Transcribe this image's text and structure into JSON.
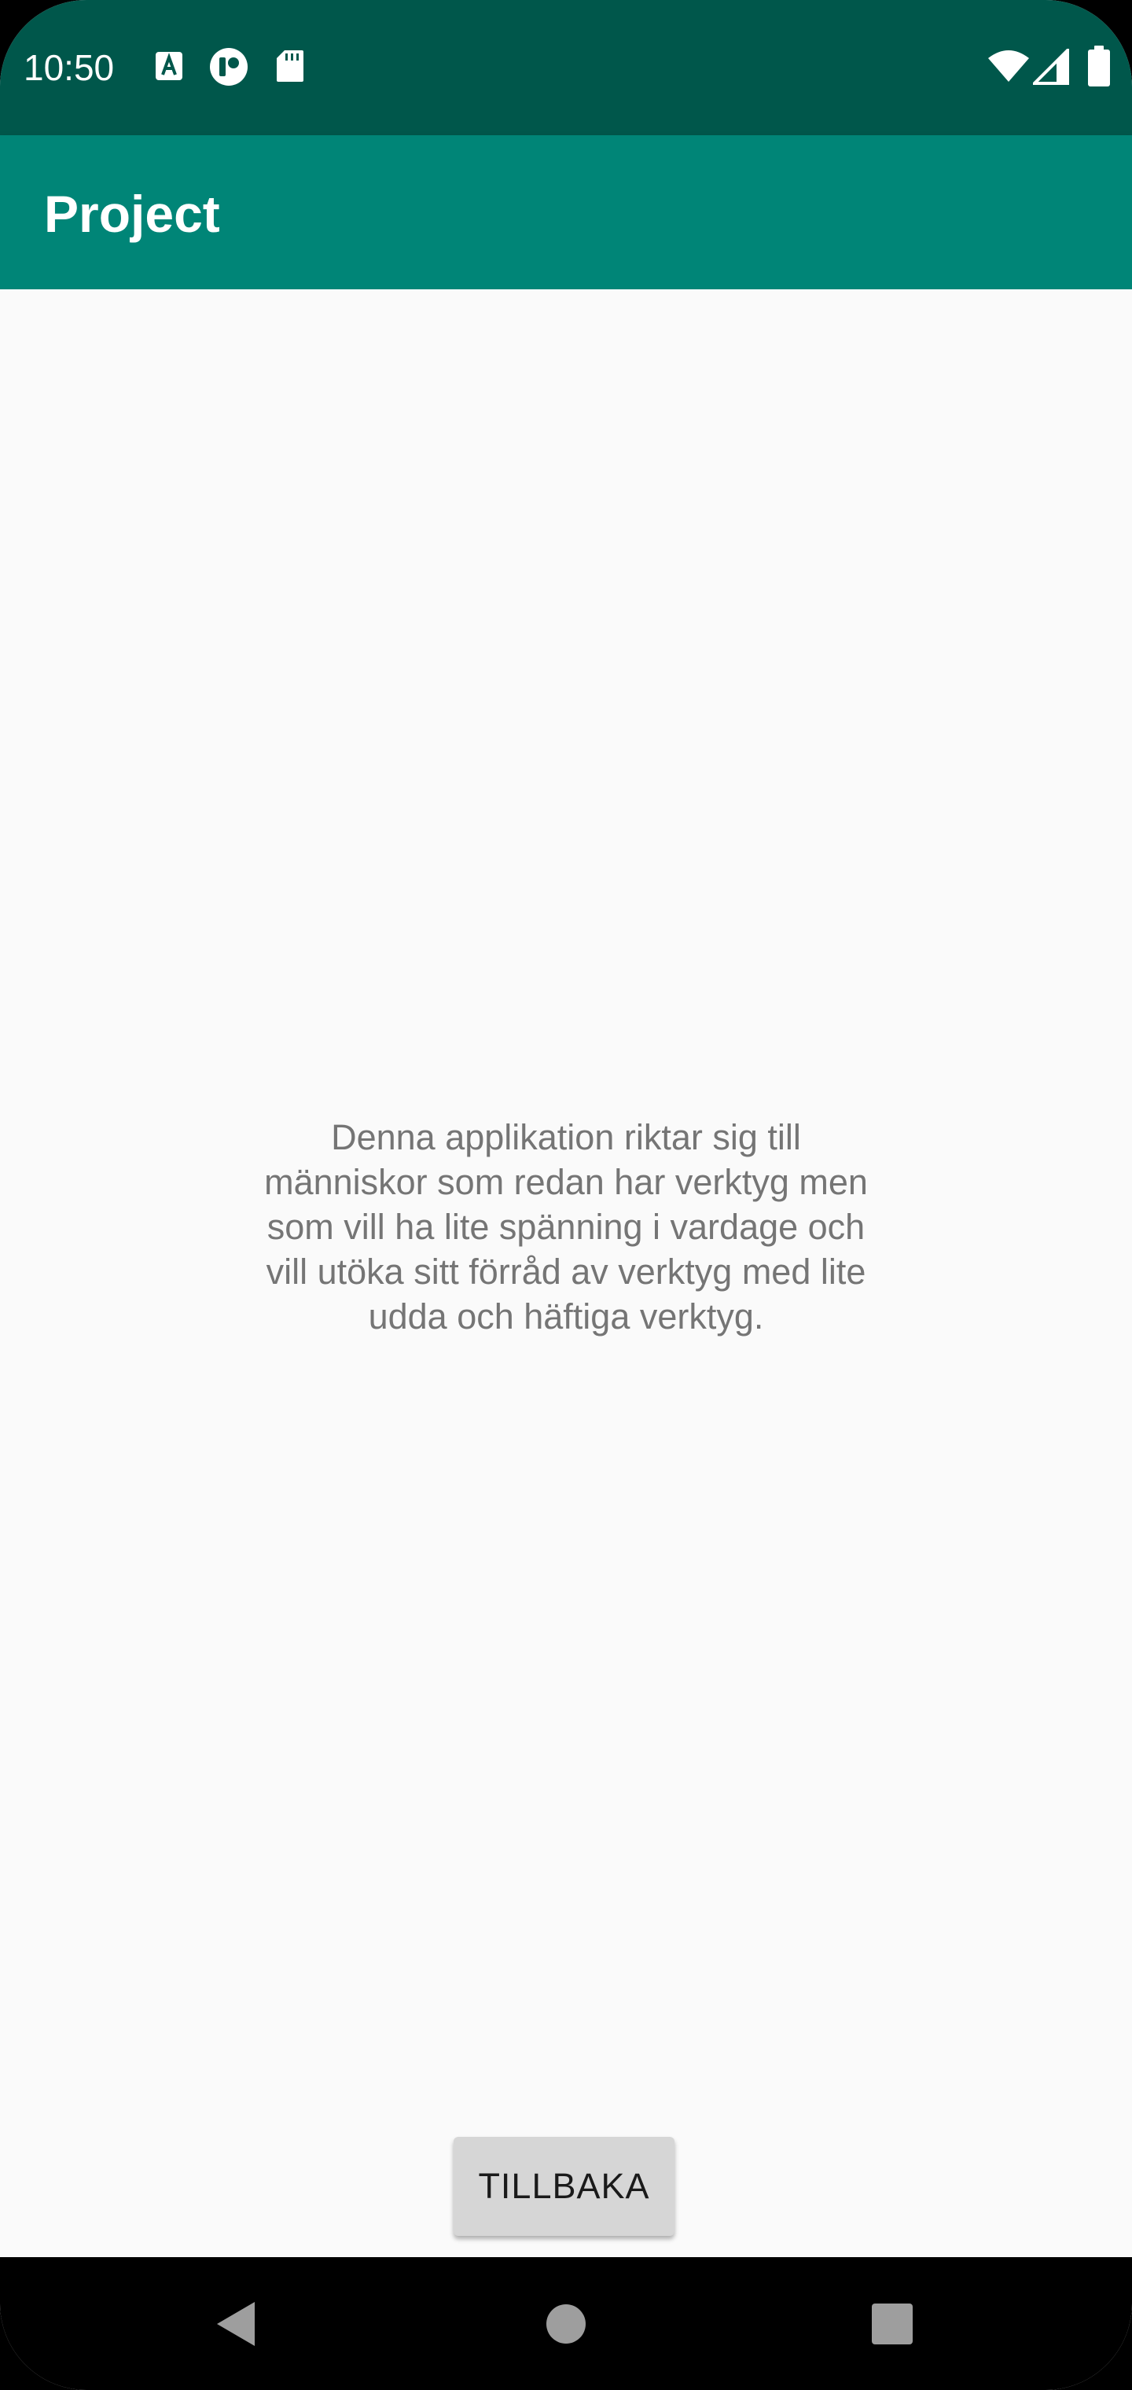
{
  "status_bar": {
    "time": "10:50",
    "left_icons": [
      "accessibility-a-icon",
      "media-icon",
      "sd-card-icon"
    ],
    "right_icons": [
      "wifi-icon",
      "cell-signal-icon",
      "battery-icon"
    ]
  },
  "app_bar": {
    "title": "Project",
    "color": "#008577",
    "status_color": "#00574b"
  },
  "main": {
    "description": "Denna applikation riktar sig till människor som redan har verktyg men som vill ha lite spänning i vardage och vill utöka sitt förråd av verktyg med lite udda och häftiga verktyg.",
    "back_button_label": "TILLBAKA"
  },
  "nav_bar": {
    "items": [
      "back-triangle-icon",
      "home-circle-icon",
      "recents-square-icon"
    ]
  }
}
